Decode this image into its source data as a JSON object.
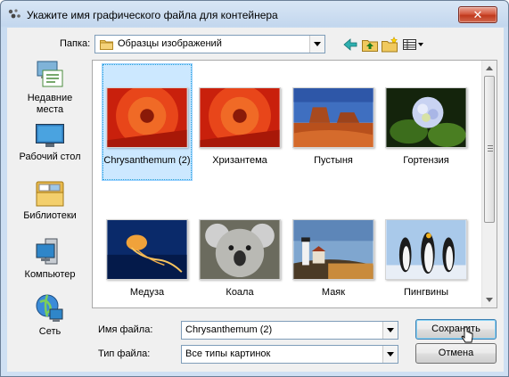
{
  "window": {
    "title": "Укажите имя графического файла для контейнера",
    "close_label": "✕"
  },
  "folder_bar": {
    "label": "Папка:",
    "value": "Образцы изображений"
  },
  "toolbar": {
    "icons": [
      "back-arrow-icon",
      "up-folder-icon",
      "new-folder-icon",
      "view-menu-icon"
    ]
  },
  "places": [
    {
      "label": "Недавние места",
      "icon": "recent-places-icon"
    },
    {
      "label": "Рабочий стол",
      "icon": "desktop-icon"
    },
    {
      "label": "Библиотеки",
      "icon": "libraries-icon"
    },
    {
      "label": "Компьютер",
      "icon": "computer-icon"
    },
    {
      "label": "Сеть",
      "icon": "network-icon"
    }
  ],
  "files": [
    {
      "name": "Chrysanthemum (2)",
      "selected": true
    },
    {
      "name": "Хризантема",
      "selected": false
    },
    {
      "name": "Пустыня",
      "selected": false
    },
    {
      "name": "Гортензия",
      "selected": false
    },
    {
      "name": "Медуза",
      "selected": false
    },
    {
      "name": "Коала",
      "selected": false
    },
    {
      "name": "Маяк",
      "selected": false
    },
    {
      "name": "Пингвины",
      "selected": false
    }
  ],
  "filename": {
    "label": "Имя файла:",
    "value": "Chrysanthemum (2)"
  },
  "filetype": {
    "label": "Тип файла:",
    "value": "Все типы картинок"
  },
  "buttons": {
    "save": "Сохранить",
    "cancel": "Отмена"
  },
  "colors": {
    "selection": "#cce8ff",
    "close_button": "#c0391d",
    "accent": "#3c7fb1"
  }
}
